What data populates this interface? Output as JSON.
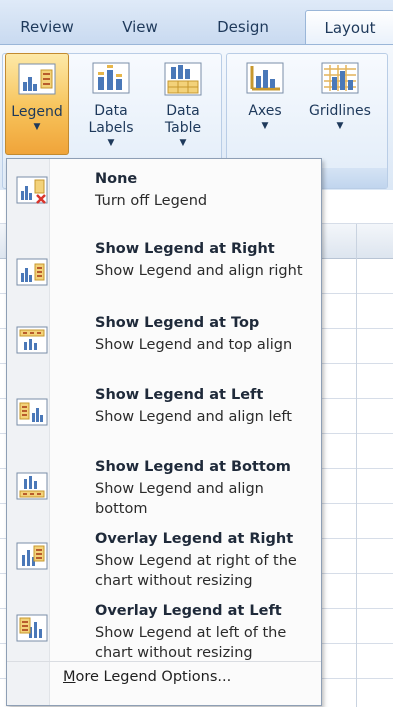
{
  "tabs": [
    "Review",
    "View",
    "Design",
    "Layout"
  ],
  "active_tab": "Layout",
  "ribbon": {
    "buttons": [
      {
        "label": "Legend",
        "icon": "legend-icon"
      },
      {
        "label": "Data Labels",
        "icon": "data-labels-icon"
      },
      {
        "label": "Data Table",
        "icon": "data-table-icon"
      },
      {
        "label": "Axes",
        "icon": "axes-icon"
      },
      {
        "label": "Gridlines",
        "icon": "gridlines-icon"
      }
    ],
    "group_caption_fragment": "s"
  },
  "menu": {
    "items": [
      {
        "title": "None",
        "desc": "Turn off Legend",
        "icon": "legend-none-icon"
      },
      {
        "title": "Show Legend at Right",
        "desc": "Show Legend and align right",
        "icon": "legend-right-icon"
      },
      {
        "title": "Show Legend at Top",
        "desc": "Show Legend and top align",
        "icon": "legend-top-icon"
      },
      {
        "title": "Show Legend at Left",
        "desc": "Show Legend and align left",
        "icon": "legend-left-icon"
      },
      {
        "title": "Show Legend at Bottom",
        "desc": "Show Legend and align bottom",
        "icon": "legend-bottom-icon"
      },
      {
        "title": "Overlay Legend at Right",
        "desc": "Show Legend at right of the chart without resizing",
        "icon": "overlay-legend-right-icon"
      },
      {
        "title": "Overlay Legend at Left",
        "desc": "Show Legend at left of the chart without resizing",
        "icon": "overlay-legend-left-icon"
      }
    ],
    "more_options_label": "More Legend Options...",
    "more_options_underline": "M",
    "more_options_rest": "ore Legend Options..."
  },
  "colors": {
    "ribbon_active": "#f7c35a",
    "tab_text": "#1e395b",
    "menu_border": "#8e9fb5"
  }
}
